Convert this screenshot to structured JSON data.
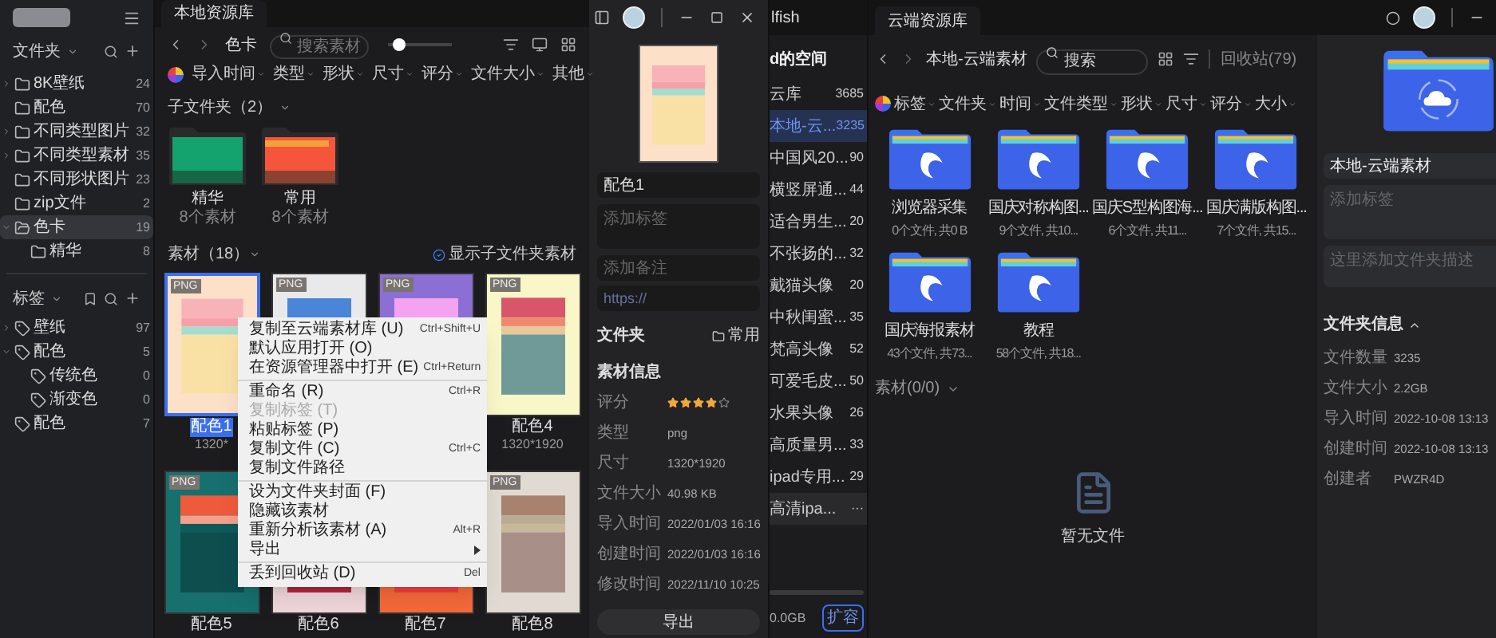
{
  "sidebar": {
    "folders_title": "文件夹",
    "folders": [
      {
        "name": "8K壁纸",
        "count": "24",
        "expanded": false,
        "selected": false
      },
      {
        "name": "配色",
        "count": "70",
        "selected": false
      },
      {
        "name": "不同类型图片",
        "count": "32",
        "expanded": false,
        "selected": false
      },
      {
        "name": "不同类型素材",
        "count": "35",
        "expanded": false,
        "selected": false
      },
      {
        "name": "不同形状图片",
        "count": "23",
        "selected": false
      },
      {
        "name": "zip文件",
        "count": "2",
        "selected": false
      },
      {
        "name": "色卡",
        "count": "19",
        "expanded": true,
        "selected": true,
        "children": [
          {
            "name": "精华",
            "count": "8",
            "selected": false
          }
        ]
      }
    ],
    "tags_title": "标签",
    "tags": [
      {
        "name": "壁纸",
        "count": "97",
        "expanded": false,
        "selected": false
      },
      {
        "name": "配色",
        "count": "5",
        "expanded": true,
        "selected": false,
        "children": [
          {
            "name": "传统色",
            "count": "0",
            "selected": false
          },
          {
            "name": "渐变色",
            "count": "0",
            "selected": false
          }
        ]
      },
      {
        "name": "配色",
        "count": "7",
        "selected": false
      }
    ]
  },
  "library": {
    "tab": "本地资源库",
    "breadcrumb": "色卡",
    "search": {
      "placeholder": "搜索素材"
    },
    "zoom": {
      "level": 0.18
    },
    "filters": [
      "导入时间",
      "类型",
      "形状",
      "尺寸",
      "评分",
      "文件大小",
      "其他"
    ],
    "subfolders_title": "子文件夹（2）",
    "subfolders": [
      {
        "name": "精华",
        "count": "8个素材"
      },
      {
        "name": "常用",
        "count": "8个素材"
      }
    ],
    "assets_title": "素材（18）",
    "show_subfolder_assets": {
      "label": "显示子文件夹素材",
      "checked": true
    },
    "assets": [
      {
        "badge": "PNG",
        "name": "配色1",
        "size": "1320*",
        "selected": true
      },
      {
        "badge": "PNG",
        "selected": false
      },
      {
        "badge": "PNG",
        "selected": false
      },
      {
        "badge": "PNG",
        "name": "配色4",
        "size": "1320*1920",
        "selected": false
      },
      {
        "badge": "PNG",
        "name": "配色5",
        "selected": false
      },
      {
        "name": "配色6"
      },
      {
        "name": "配色7"
      },
      {
        "badge": "PNG",
        "name": "配色8",
        "selected": false
      }
    ]
  },
  "context_menu": {
    "groups": [
      [
        {
          "label": "复制至云端素材库 (U)",
          "shortcut": "Ctrl+Shift+U",
          "disabled": false
        },
        {
          "label": "默认应用打开 (O)",
          "disabled": false
        },
        {
          "label": "在资源管理器中打开 (E)",
          "shortcut": "Ctrl+Return",
          "disabled": false
        }
      ],
      [
        {
          "label": "重命名 (R)",
          "shortcut": "Ctrl+R",
          "disabled": false
        },
        {
          "label": "复制标签 (T)",
          "disabled": true
        },
        {
          "label": "粘贴标签 (P)",
          "disabled": false
        },
        {
          "label": "复制文件 (C)",
          "shortcut": "Ctrl+C",
          "disabled": false
        },
        {
          "label": "复制文件路径",
          "disabled": false
        }
      ],
      [
        {
          "label": "设为文件夹封面 (F)",
          "disabled": false
        },
        {
          "label": "隐藏该素材",
          "disabled": false
        },
        {
          "label": "重新分析该素材 (A)",
          "shortcut": "Alt+R",
          "disabled": false
        },
        {
          "label": "导出",
          "submenu": true,
          "disabled": false
        }
      ],
      [
        {
          "label": "丢到回收站 (D)",
          "shortcut": "Del",
          "disabled": false
        }
      ]
    ]
  },
  "inspector": {
    "name": "配色1",
    "tags_placeholder": "添加标签",
    "note_placeholder": "添加备注",
    "url_placeholder": "https://",
    "folder_label": "文件夹",
    "folder": "常用",
    "info_title": "素材信息",
    "rating": {
      "label": "评分",
      "stars": 4
    },
    "rows": [
      {
        "label": "类型",
        "value": "png"
      },
      {
        "label": "尺寸",
        "value": "1320*1920"
      },
      {
        "label": "文件大小",
        "value": "40.98 KB"
      },
      {
        "label": "导入时间",
        "value": "2022/01/03 16:16"
      },
      {
        "label": "创建时间",
        "value": "2022/01/03 16:16"
      },
      {
        "label": "修改时间",
        "value": "2022/11/10 10:25"
      }
    ],
    "export": "导出"
  },
  "middle_window": {
    "title": "lfish",
    "space": "d的空间",
    "items": [
      {
        "name": "云库",
        "count": "3685",
        "selected": false
      },
      {
        "name": "本地-云...",
        "count": "3235",
        "selected": true
      },
      {
        "name": "中国风20...",
        "count": "90",
        "selected": false
      },
      {
        "name": "横竖屏通...",
        "count": "44",
        "selected": false
      },
      {
        "name": "适合男生...",
        "count": "20",
        "selected": false
      },
      {
        "name": "不张扬的...",
        "count": "32",
        "selected": false
      },
      {
        "name": "戴猫头像",
        "count": "20",
        "selected": false
      },
      {
        "name": "中秋闺蜜...",
        "count": "35",
        "selected": false
      },
      {
        "name": "梵高头像",
        "count": "52",
        "selected": false
      },
      {
        "name": "可爱毛皮...",
        "count": "50",
        "selected": false
      },
      {
        "name": "水果头像",
        "count": "26",
        "selected": false
      },
      {
        "name": "高质量男...",
        "count": "33",
        "selected": false
      },
      {
        "name": "ipad专用...",
        "count": "29",
        "selected": false
      },
      {
        "name": "高清ipa...",
        "more": "···",
        "selected": false
      }
    ],
    "storage": "0.0GB",
    "upgrade": "扩容"
  },
  "right_window": {
    "tab": "云端资源库",
    "breadcrumb": "本地-云端素材",
    "search": {
      "placeholder": "搜索"
    },
    "trash": "回收站(79)",
    "filters": [
      "标签",
      "文件夹",
      "时间",
      "文件类型",
      "形状",
      "尺寸",
      "评分",
      "大小"
    ],
    "folders": [
      {
        "name": "浏览器采集",
        "info": "0个文件, 共0 B"
      },
      {
        "name": "国庆对称构图...",
        "info": "9个文件, 共10..."
      },
      {
        "name": "国庆S型构图海...",
        "info": "6个文件, 共11..."
      },
      {
        "name": "国庆满版构图...",
        "info": "7个文件, 共15..."
      },
      {
        "name": "国庆海报素材",
        "info": "43个文件, 共73..."
      },
      {
        "name": "教程",
        "info": "58个文件, 共18..."
      }
    ],
    "assets_title": "素材(0/0)",
    "empty": "暂无文件",
    "inspector": {
      "name": "本地-云端素材",
      "tags_placeholder": "添加标签",
      "description_placeholder": "这里添加文件夹描述",
      "info_title": "文件夹信息",
      "info_expanded": true,
      "rows": [
        {
          "label": "文件数量",
          "value": "3235"
        },
        {
          "label": "文件大小",
          "value": "2.2GB"
        },
        {
          "label": "导入时间",
          "value": "2022-10-08 13:13"
        },
        {
          "label": "创建时间",
          "value": "2022-10-08 13:13"
        },
        {
          "label": "创建者",
          "value": "PWZR4D"
        }
      ]
    }
  }
}
